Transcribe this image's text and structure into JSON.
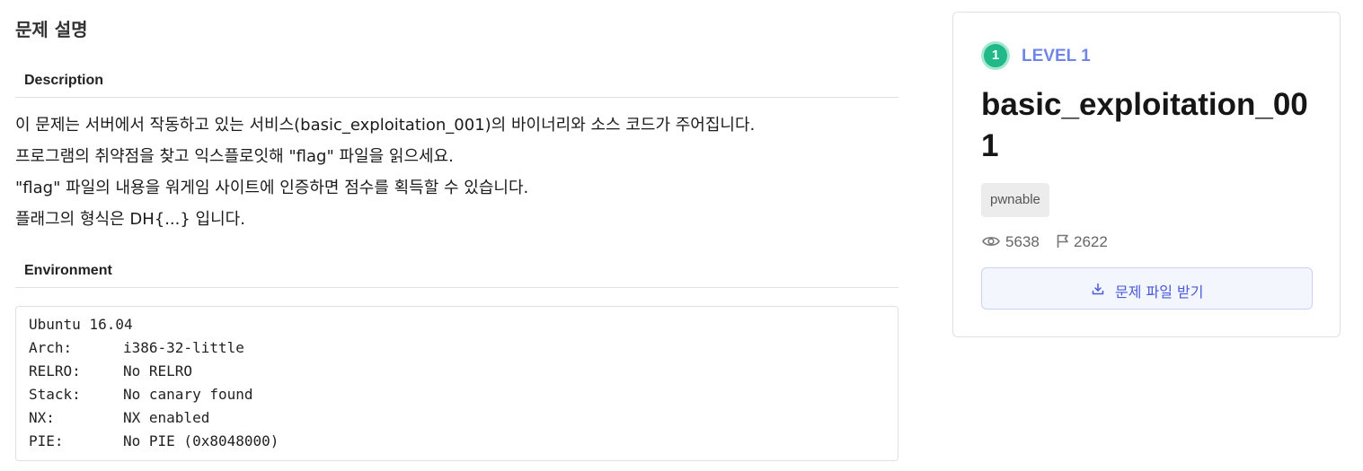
{
  "page": {
    "section_title": "문제 설명"
  },
  "description": {
    "heading": "Description",
    "lines": [
      "이 문제는 서버에서 작동하고 있는 서비스(basic_exploitation_001)의 바이너리와 소스 코드가 주어집니다.",
      "프로그램의 취약점을 찾고 익스플로잇해 \"flag\" 파일을 읽으세요.",
      "\"flag\" 파일의 내용을 워게임 사이트에 인증하면 점수를 획득할 수 있습니다.",
      "플래그의 형식은 DH{...} 입니다."
    ]
  },
  "environment": {
    "heading": "Environment",
    "first_line": "Ubuntu 16.04",
    "rows": [
      {
        "key": "Arch:",
        "value": "i386-32-little"
      },
      {
        "key": "RELRO:",
        "value": "No RELRO"
      },
      {
        "key": "Stack:",
        "value": "No canary found"
      },
      {
        "key": "NX:",
        "value": "NX enabled"
      },
      {
        "key": "PIE:",
        "value": "No PIE (0x8048000)"
      }
    ]
  },
  "card": {
    "level_number": "1",
    "level_label": "LEVEL 1",
    "challenge_name": "basic_exploitation_001",
    "tag": "pwnable",
    "views": "5638",
    "solves": "2622",
    "download_label": "문제 파일 받기",
    "icons": {
      "views": "eye-icon",
      "solves": "flag-icon",
      "download": "download-icon"
    },
    "colors": {
      "level_badge": "#21b98a",
      "level_text": "#6f86e8",
      "button_text": "#4a5ad8",
      "button_bg": "#f4f6fe"
    }
  }
}
